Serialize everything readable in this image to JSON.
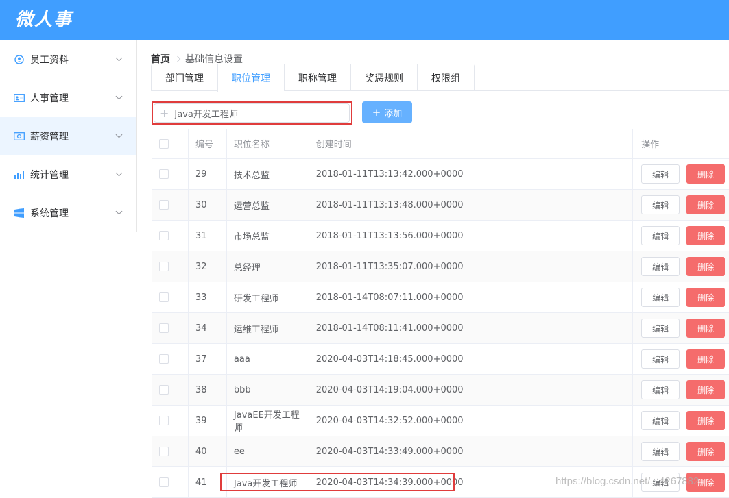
{
  "app": {
    "title": "微人事"
  },
  "sidebar": {
    "items": [
      {
        "label": "员工资料",
        "icon": "user-circle-icon"
      },
      {
        "label": "人事管理",
        "icon": "id-card-icon"
      },
      {
        "label": "薪资管理",
        "icon": "money-icon"
      },
      {
        "label": "统计管理",
        "icon": "bar-chart-icon"
      },
      {
        "label": "系统管理",
        "icon": "windows-icon"
      }
    ],
    "active_index": 2
  },
  "breadcrumb": {
    "home": "首页",
    "current": "基础信息设置"
  },
  "tabs": [
    {
      "label": "部门管理"
    },
    {
      "label": "职位管理"
    },
    {
      "label": "职称管理"
    },
    {
      "label": "奖惩规则"
    },
    {
      "label": "权限组"
    }
  ],
  "active_tab": 1,
  "search": {
    "value": "Java开发工程师"
  },
  "add_button": {
    "label": "添加"
  },
  "table": {
    "headers": {
      "id": "编号",
      "name": "职位名称",
      "time": "创建时间",
      "ops": "操作"
    },
    "edit_label": "编辑",
    "delete_label": "删除",
    "rows": [
      {
        "id": "29",
        "name": "技术总监",
        "time": "2018-01-11T13:13:42.000+0000"
      },
      {
        "id": "30",
        "name": "运营总监",
        "time": "2018-01-11T13:13:48.000+0000"
      },
      {
        "id": "31",
        "name": "市场总监",
        "time": "2018-01-11T13:13:56.000+0000"
      },
      {
        "id": "32",
        "name": "总经理",
        "time": "2018-01-11T13:35:07.000+0000"
      },
      {
        "id": "33",
        "name": "研发工程师",
        "time": "2018-01-14T08:07:11.000+0000"
      },
      {
        "id": "34",
        "name": "运维工程师",
        "time": "2018-01-14T08:11:41.000+0000"
      },
      {
        "id": "37",
        "name": "aaa",
        "time": "2020-04-03T14:18:45.000+0000"
      },
      {
        "id": "38",
        "name": "bbb",
        "time": "2020-04-03T14:19:04.000+0000"
      },
      {
        "id": "39",
        "name": "JavaEE开发工程师",
        "time": "2020-04-03T14:32:52.000+0000"
      },
      {
        "id": "40",
        "name": "ee",
        "time": "2020-04-03T14:33:49.000+0000"
      },
      {
        "id": "41",
        "name": "Java开发工程师",
        "time": "2020-04-03T14:34:39.000+0000"
      }
    ]
  },
  "watermark": "https://blog.csdn.net/...4267882",
  "colors": {
    "primary": "#409eff",
    "danger": "#f56c6c",
    "highlight": "#e03c3c"
  }
}
